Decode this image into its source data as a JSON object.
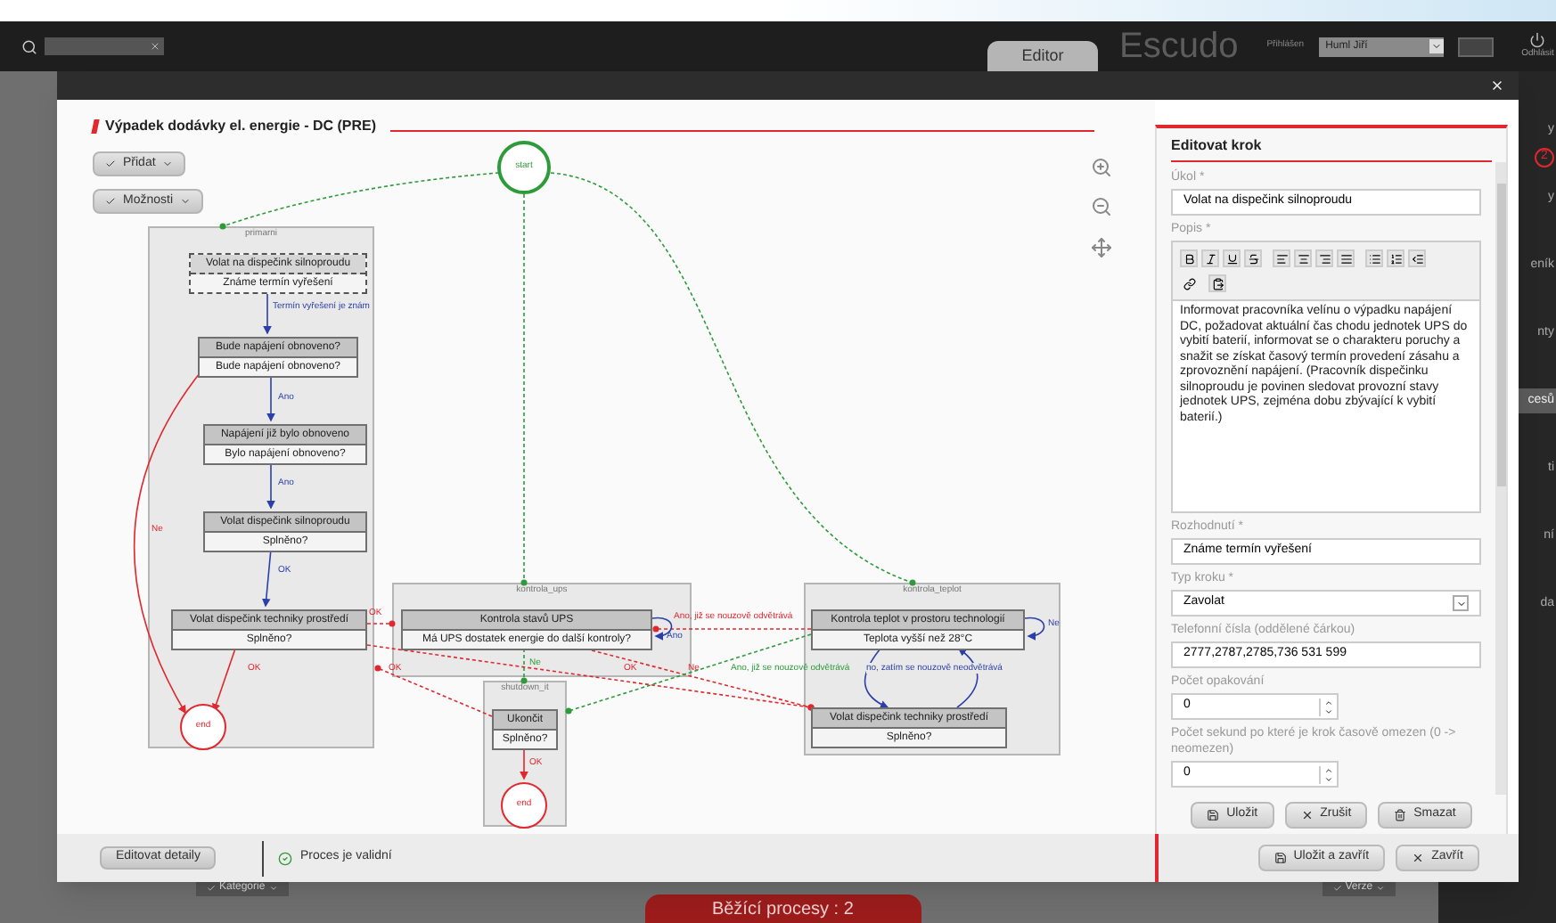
{
  "app_bar": {
    "tabs": [
      {
        "label": "Editor",
        "selected": true
      }
    ],
    "logo": "Escudo",
    "login_label": "Přihlášen",
    "user": "Huml Jiří",
    "logout": "Odhlásit"
  },
  "sidebar": {
    "badge": "2",
    "items": [
      {
        "label": "y",
        "selected": false
      },
      {
        "label": "y",
        "selected": false
      },
      {
        "label": "eník",
        "selected": false
      },
      {
        "label": "nty",
        "selected": false
      },
      {
        "label": "cesů",
        "selected": true
      },
      {
        "label": "ti",
        "selected": false
      },
      {
        "label": "ní",
        "selected": false
      },
      {
        "label": "da",
        "selected": false
      }
    ]
  },
  "background_toolbar": {
    "buttons": [
      "Kategorie",
      "Verze"
    ],
    "running_tab": "Běžící procesy : 2"
  },
  "dialog": {
    "title": "Výpadek dodávky el. energie - DC (PRE)",
    "toolbar": [
      "Přidat",
      "Možnosti"
    ],
    "diagram": {
      "markers": [
        {
          "kind": "start",
          "label": "start"
        },
        {
          "kind": "end",
          "label": "end"
        },
        {
          "kind": "end",
          "label": "end"
        }
      ],
      "lanes": [
        {
          "name": "primarni"
        },
        {
          "name": "kontrola_ups"
        },
        {
          "name": "kontrola_teplot"
        },
        {
          "name": "shutdown_it"
        }
      ],
      "steps": [
        {
          "title": "Volat na dispečink silnoproudu",
          "decision": "Známe termín vyřešení",
          "selected": true
        },
        {
          "title": "Bude napájení obnoveno?",
          "decision": "Bude napájení obnoveno?",
          "selected": false
        },
        {
          "title": "Napájení již bylo obnoveno",
          "decision": "Bylo napájení obnoveno?",
          "selected": false
        },
        {
          "title": "Volat dispečink silnoproudu",
          "decision": "Splněno?",
          "selected": false
        },
        {
          "title": "Volat dispečink techniky prostředí",
          "decision": "Splněno?",
          "selected": false
        },
        {
          "title": "Kontrola stavů UPS",
          "decision": "Má UPS dostatek energie do další kontroly?",
          "selected": false
        },
        {
          "title": "Kontrola teplot v prostoru technologií",
          "decision": "Teplota vyšší než 28°C",
          "selected": false
        },
        {
          "title": "Ukončit",
          "decision": "Splněno?",
          "selected": false
        },
        {
          "title": "Volat dispečink techniky prostředí",
          "decision": "Splněno?",
          "selected": false
        }
      ],
      "edges": [
        {
          "color": "#2e9b3a",
          "kind": "dashed"
        },
        {
          "color": "#2e9b3a",
          "kind": "dashed"
        },
        {
          "color": "#2e9b3a",
          "kind": "dashed"
        },
        {
          "label": "Termín vyřešení je znám",
          "color": "#2b3fa8",
          "kind": "solid"
        },
        {
          "label": "Ano",
          "color": "#2b3fa8",
          "kind": "solid"
        },
        {
          "label": "Ano",
          "color": "#2b3fa8",
          "kind": "solid"
        },
        {
          "label": "OK",
          "color": "#2b3fa8",
          "kind": "solid"
        },
        {
          "label": "Ne",
          "color": "#e0282e",
          "kind": "solid"
        },
        {
          "label": "OK",
          "color": "#e0282e",
          "kind": "solid"
        },
        {
          "label": "OK",
          "color": "#e0282e",
          "kind": "dashed"
        },
        {
          "label": "OK",
          "color": "#e0282e",
          "kind": "dashed"
        },
        {
          "label": "OK",
          "color": "#e0282e",
          "kind": "dashed"
        },
        {
          "label": "Ne",
          "color": "#e0282e",
          "kind": "dashed"
        },
        {
          "label": "Ano, již se nouzově odvětrává",
          "color": "#e0282e",
          "kind": "dashed"
        },
        {
          "label": "Ano",
          "color": "#2b3fa8",
          "kind": "solid"
        },
        {
          "label": "Ne",
          "color": "#2b3fa8",
          "kind": "solid"
        },
        {
          "label": "Ne",
          "color": "#2e9b3a",
          "kind": "dashed"
        },
        {
          "label": "Ano, již se nouzově odvětrává",
          "color": "#2e9b3a",
          "kind": "dashed"
        },
        {
          "label": "no, zatím se nouzově neodvětrává",
          "color": "#2b3fa8",
          "kind": "solid"
        },
        {
          "color": "#2b3fa8",
          "kind": "solid"
        },
        {
          "label": "OK",
          "color": "#e0282e",
          "kind": "solid"
        }
      ]
    },
    "editor_panel": {
      "title": "Editovat krok",
      "fields": [
        {
          "kind": "text",
          "label": "Úkol *",
          "value": "Volat na dispečink silnoproudu"
        },
        {
          "kind": "richtext",
          "label": "Popis *",
          "value": "Informovat pracovníka velínu o výpadku napájení DC, požadovat aktuální čas chodu jednotek UPS do vybití baterií, informovat se o charakteru poruchy a snažit se získat časový termín provedení zásahu a zprovoznění napájení. (Pracovník dispečinku silnoproudu je povinen sledovat provozní stavy jednotek UPS, zejména dobu zbývající k vybití baterií.)"
        },
        {
          "kind": "text",
          "label": "Rozhodnutí *",
          "value": "Známe termín vyřešení"
        },
        {
          "kind": "select",
          "label": "Typ kroku *",
          "value": "Zavolat"
        },
        {
          "kind": "text",
          "label": "Telefonní čísla (oddělené čárkou)",
          "value": "2777,2787,2785,736 531 599"
        },
        {
          "kind": "number",
          "label": "Počet opakování",
          "value": "0"
        },
        {
          "kind": "number",
          "label": "Počet sekund po které je krok časově omezen (0 -> neomezen)",
          "value": "0"
        }
      ],
      "buttons": [
        {
          "label": "Uložit",
          "kind": "save"
        },
        {
          "label": "Zrušit",
          "kind": "cancel"
        },
        {
          "label": "Smazat",
          "kind": "delete"
        }
      ]
    },
    "footer": {
      "details_button": "Editovat detaily",
      "status": {
        "text": "Proces je validní",
        "valid": true
      },
      "buttons": [
        {
          "label": "Uložit a zavřít",
          "kind": "save"
        },
        {
          "label": "Zavřít",
          "kind": "cancel"
        }
      ]
    }
  }
}
